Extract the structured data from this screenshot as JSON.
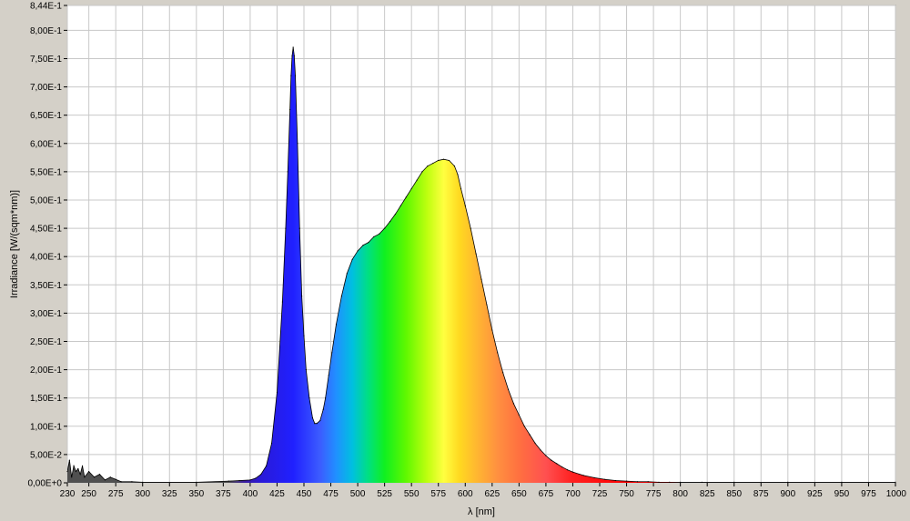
{
  "chart_data": {
    "type": "area",
    "title": "",
    "xlabel": "λ [nm]",
    "ylabel": "Irradiance [W/(sqm*nm)]",
    "xlim": [
      230,
      1000
    ],
    "ylim": [
      0,
      0.844
    ],
    "grid": true,
    "xtick_labels": [
      "230",
      "250",
      "275",
      "300",
      "325",
      "350",
      "375",
      "400",
      "425",
      "450",
      "475",
      "500",
      "525",
      "550",
      "575",
      "600",
      "625",
      "650",
      "675",
      "700",
      "725",
      "750",
      "775",
      "800",
      "825",
      "850",
      "875",
      "900",
      "925",
      "950",
      "975",
      "1000"
    ],
    "ytick_labels": [
      "0,00E+0",
      "5,00E-2",
      "1,00E-1",
      "1,50E-1",
      "2,00E-1",
      "2,50E-1",
      "3,00E-1",
      "3,50E-1",
      "4,00E-1",
      "4,50E-1",
      "5,00E-1",
      "5,50E-1",
      "6,00E-1",
      "6,50E-1",
      "7,00E-1",
      "7,50E-1",
      "8,00E-1",
      "8,44E-1"
    ],
    "x": [
      230,
      232,
      234,
      236,
      238,
      240,
      242,
      244,
      246,
      250,
      255,
      260,
      265,
      270,
      275,
      280,
      290,
      300,
      350,
      380,
      390,
      400,
      405,
      410,
      415,
      420,
      425,
      430,
      433,
      435,
      437,
      438,
      439,
      440,
      441,
      442,
      444,
      446,
      448,
      450,
      452,
      455,
      458,
      460,
      462,
      465,
      468,
      470,
      473,
      476,
      480,
      485,
      490,
      495,
      500,
      505,
      510,
      515,
      520,
      525,
      530,
      535,
      540,
      545,
      550,
      555,
      560,
      565,
      570,
      575,
      580,
      585,
      590,
      593,
      596,
      600,
      605,
      610,
      615,
      620,
      625,
      630,
      635,
      640,
      645,
      650,
      655,
      660,
      665,
      670,
      675,
      680,
      685,
      690,
      695,
      700,
      710,
      720,
      730,
      740,
      750,
      760,
      770,
      780,
      790,
      800,
      820,
      850,
      900,
      950,
      1000
    ],
    "values": [
      0.02,
      0.04,
      0.01,
      0.03,
      0.02,
      0.025,
      0.015,
      0.03,
      0.01,
      0.02,
      0.01,
      0.015,
      0.005,
      0.01,
      0.006,
      0.002,
      0.002,
      0.001,
      0.001,
      0.003,
      0.004,
      0.005,
      0.008,
      0.015,
      0.03,
      0.07,
      0.16,
      0.32,
      0.45,
      0.55,
      0.66,
      0.72,
      0.755,
      0.77,
      0.755,
      0.72,
      0.6,
      0.45,
      0.33,
      0.26,
      0.2,
      0.15,
      0.115,
      0.105,
      0.105,
      0.11,
      0.13,
      0.15,
      0.19,
      0.23,
      0.28,
      0.33,
      0.37,
      0.395,
      0.41,
      0.42,
      0.425,
      0.435,
      0.44,
      0.45,
      0.462,
      0.475,
      0.49,
      0.505,
      0.52,
      0.535,
      0.55,
      0.56,
      0.565,
      0.57,
      0.572,
      0.57,
      0.56,
      0.545,
      0.52,
      0.49,
      0.45,
      0.405,
      0.36,
      0.315,
      0.27,
      0.23,
      0.195,
      0.165,
      0.14,
      0.12,
      0.1,
      0.085,
      0.07,
      0.058,
      0.048,
      0.04,
      0.034,
      0.028,
      0.023,
      0.019,
      0.013,
      0.009,
      0.006,
      0.004,
      0.003,
      0.002,
      0.002,
      0.001,
      0.001,
      0.001,
      0.001,
      0.001,
      0.001,
      0.001,
      0.001
    ]
  }
}
